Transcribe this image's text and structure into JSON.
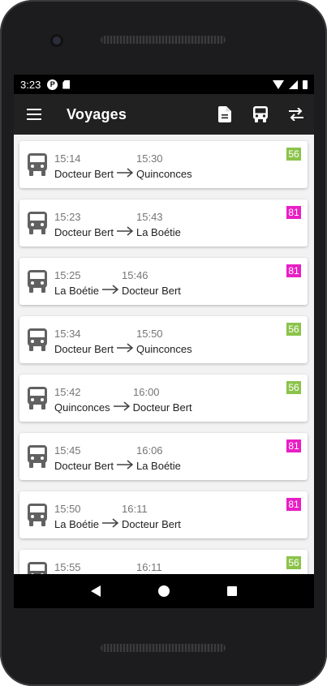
{
  "status": {
    "time": "3:23",
    "notif_glyph": "P"
  },
  "appbar": {
    "title": "Voyages"
  },
  "icons": {
    "menu": "menu-icon",
    "document": "document-icon",
    "bus": "bus-icon",
    "swap": "swap-icon"
  },
  "trips": [
    {
      "dep": "15:14",
      "arr": "15:30",
      "from": "Docteur Bert",
      "to": "Quinconces",
      "line": "56",
      "color": "#8bc34a"
    },
    {
      "dep": "15:23",
      "arr": "15:43",
      "from": "Docteur Bert",
      "to": "La Boétie",
      "line": "81",
      "color": "#e91ec4"
    },
    {
      "dep": "15:25",
      "arr": "15:46",
      "from": "La Boétie",
      "to": "Docteur Bert",
      "line": "81",
      "color": "#e91ec4"
    },
    {
      "dep": "15:34",
      "arr": "15:50",
      "from": "Docteur Bert",
      "to": "Quinconces",
      "line": "56",
      "color": "#8bc34a"
    },
    {
      "dep": "15:42",
      "arr": "16:00",
      "from": "Quinconces",
      "to": "Docteur Bert",
      "line": "56",
      "color": "#8bc34a"
    },
    {
      "dep": "15:45",
      "arr": "16:06",
      "from": "Docteur Bert",
      "to": "La Boétie",
      "line": "81",
      "color": "#e91ec4"
    },
    {
      "dep": "15:50",
      "arr": "16:11",
      "from": "La Boétie",
      "to": "Docteur Bert",
      "line": "81",
      "color": "#e91ec4"
    },
    {
      "dep": "15:55",
      "arr": "16:11",
      "from": "",
      "to": "",
      "line": "56",
      "color": "#8bc34a"
    }
  ]
}
